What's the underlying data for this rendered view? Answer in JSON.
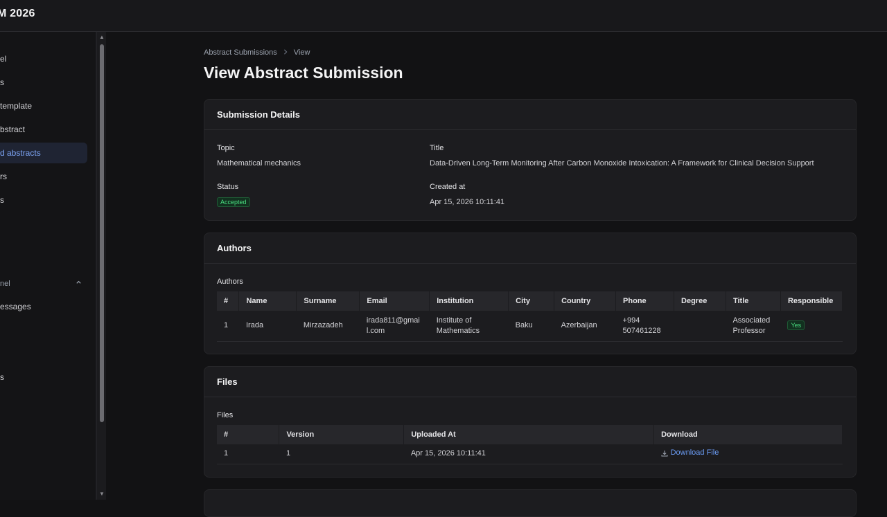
{
  "app": {
    "brand": "M 2026"
  },
  "sidebar": {
    "items": [
      {
        "label": "el",
        "active": false
      },
      {
        "label": "s",
        "active": false
      },
      {
        "label": "template",
        "active": false
      },
      {
        "label": "bstract",
        "active": false
      },
      {
        "label": "d abstracts",
        "active": true
      },
      {
        "label": "rs",
        "active": false
      },
      {
        "label": "s",
        "active": false
      }
    ],
    "section": {
      "label": "nel"
    },
    "section_items": [
      {
        "label": "essages"
      },
      {
        "label": "s"
      }
    ]
  },
  "breadcrumb": {
    "parent": "Abstract Submissions",
    "current": "View"
  },
  "page": {
    "title": "View Abstract Submission"
  },
  "details": {
    "header": "Submission Details",
    "topic_label": "Topic",
    "topic_value": "Mathematical mechanics",
    "title_label": "Title",
    "title_value": "Data-Driven Long-Term Monitoring After Carbon Monoxide Intoxication: A Framework for Clinical Decision Support",
    "status_label": "Status",
    "status_value": "Accepted",
    "created_label": "Created at",
    "created_value": "Apr 15, 2026 10:11:41"
  },
  "authors": {
    "header": "Authors",
    "sublabel": "Authors",
    "columns": [
      "#",
      "Name",
      "Surname",
      "Email",
      "Institution",
      "City",
      "Country",
      "Phone",
      "Degree",
      "Title",
      "Responsible"
    ],
    "rows": [
      {
        "num": "1",
        "name": "Irada",
        "surname": "Mirzazadeh",
        "email": "irada811@gmail.com",
        "institution": "Institute of Mathematics",
        "city": "Baku",
        "country": "Azerbaijan",
        "phone": "+994 507461228",
        "degree": "",
        "title": "Associated Professor",
        "responsible": "Yes"
      }
    ]
  },
  "files": {
    "header": "Files",
    "sublabel": "Files",
    "columns": [
      "#",
      "Version",
      "Uploaded At",
      "Download"
    ],
    "rows": [
      {
        "num": "1",
        "version": "1",
        "uploaded_at": "Apr 15, 2026 10:11:41",
        "download_label": "Download File"
      }
    ]
  },
  "colors": {
    "accent": "#6b9cf5",
    "success": "#4ade80",
    "background": "#121214"
  },
  "icons": {
    "chevron": "chevron-right-icon",
    "section_toggle": "chevron-up-icon",
    "download": "download-icon"
  }
}
